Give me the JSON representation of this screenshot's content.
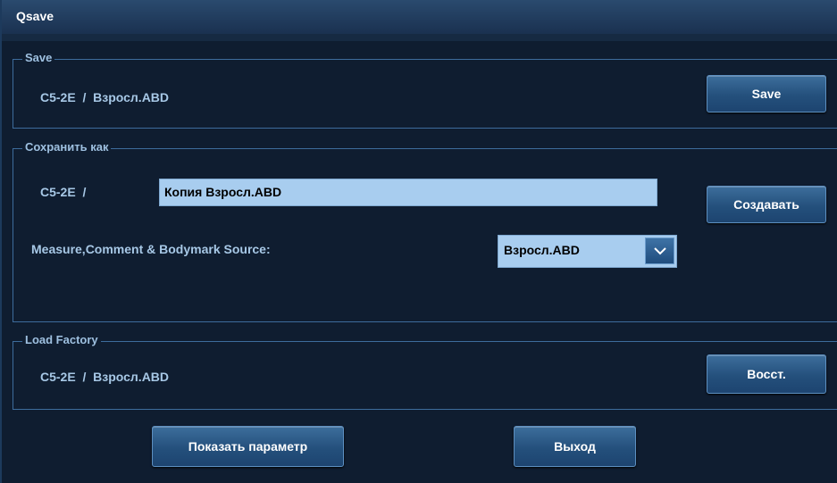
{
  "window": {
    "title": "Qsave"
  },
  "save_group": {
    "legend": "Save",
    "preset": "C5-2E  /  Взросл.ABD",
    "button_label": "Save"
  },
  "save_as_group": {
    "legend": "Сохранить как",
    "prefix": "C5-2E  /",
    "name_value": "Копия Взросл.ABD",
    "create_button_label": "Создавать",
    "source_label": "Measure,Comment & Bodymark Source:",
    "source_selected": "Взросл.ABD",
    "source_dropdown_icon": "chevron-down-icon"
  },
  "load_factory_group": {
    "legend": "Load Factory",
    "preset": "C5-2E  /  Взросл.ABD",
    "restore_button_label": "Восст."
  },
  "footer": {
    "show_params_label": "Показать параметр",
    "exit_label": "Выход"
  }
}
